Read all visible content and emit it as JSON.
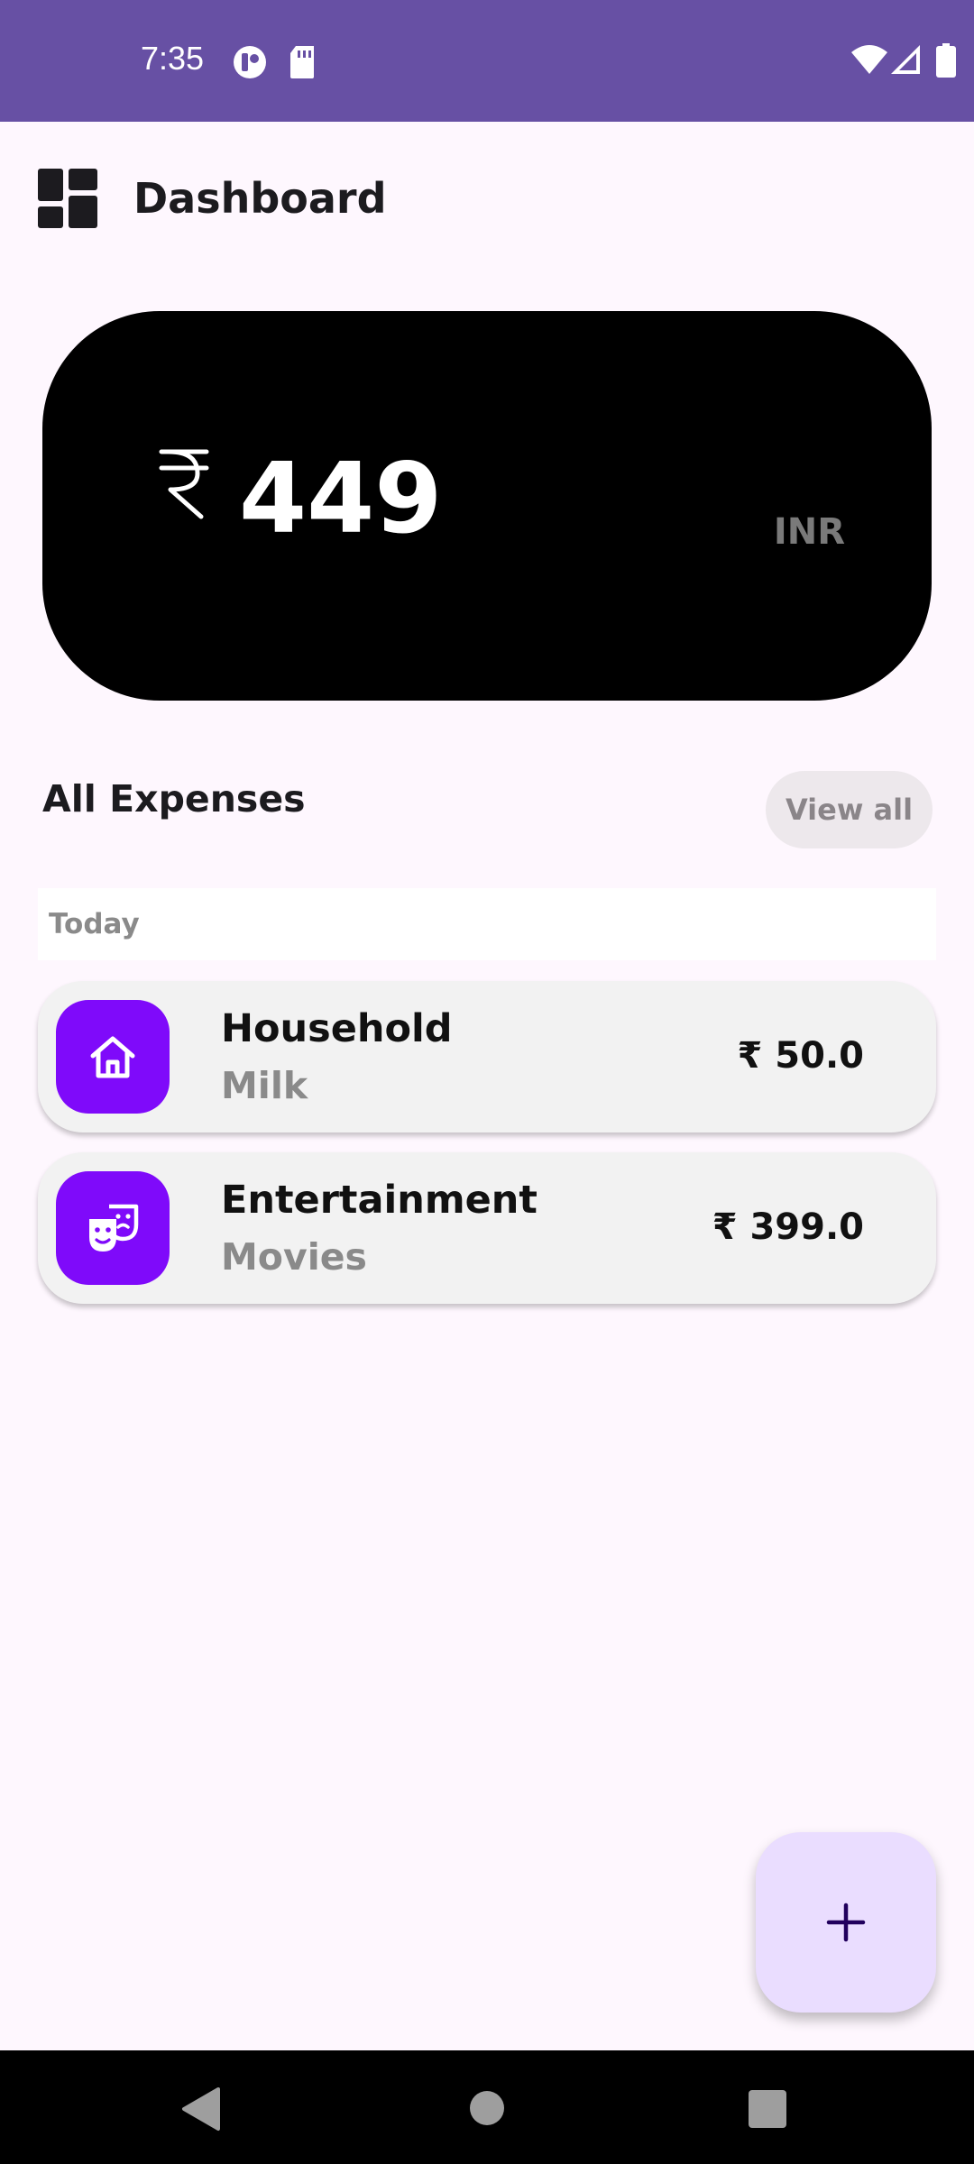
{
  "status_bar": {
    "time": "7:35",
    "icons": [
      "app-notification-icon",
      "sd-card-icon",
      "wifi-icon",
      "cellular-signal-icon",
      "battery-icon"
    ],
    "color": "#6750A4"
  },
  "header": {
    "title": "Dashboard",
    "icon": "dashboard-icon"
  },
  "balance_card": {
    "currency_symbol": "₹",
    "amount": "449",
    "currency_code": "INR"
  },
  "expenses": {
    "title": "All Expenses",
    "view_all_label": "View all",
    "groups": [
      {
        "date_label": "Today",
        "items": [
          {
            "category": "Household",
            "description": "Milk",
            "amount": "₹ 50.0",
            "icon": "home-icon"
          },
          {
            "category": "Entertainment",
            "description": "Movies",
            "amount": "₹ 399.0",
            "icon": "theater-masks-icon"
          }
        ]
      }
    ]
  },
  "fab": {
    "label": "+",
    "icon": "add-icon"
  },
  "colors": {
    "accent": "#7F0AFA",
    "fab_background": "#EADDFF",
    "page_background": "#FEF7FE"
  }
}
